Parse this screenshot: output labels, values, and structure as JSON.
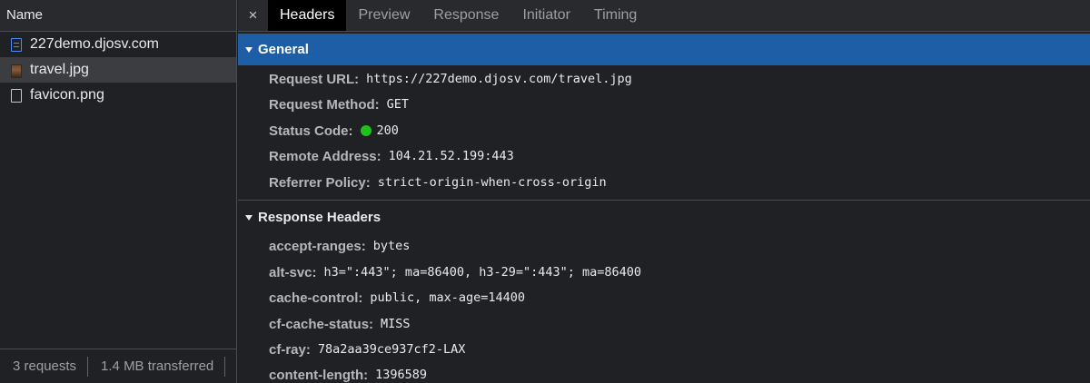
{
  "left": {
    "header": "Name",
    "requests": [
      {
        "name": "227demo.djosv.com",
        "icon": "document-icon"
      },
      {
        "name": "travel.jpg",
        "icon": "image-icon"
      },
      {
        "name": "favicon.png",
        "icon": "file-icon"
      }
    ],
    "footer": {
      "requests": "3 requests",
      "transferred": "1.4 MB transferred"
    }
  },
  "tabs": {
    "close": "×",
    "items": [
      "Headers",
      "Preview",
      "Response",
      "Initiator",
      "Timing"
    ],
    "active": "Headers"
  },
  "general": {
    "title": "General",
    "rows": [
      {
        "name": "Request URL:",
        "value": "https://227demo.djosv.com/travel.jpg"
      },
      {
        "name": "Request Method:",
        "value": "GET"
      },
      {
        "name": "Status Code:",
        "value": "200"
      },
      {
        "name": "Remote Address:",
        "value": "104.21.52.199:443"
      },
      {
        "name": "Referrer Policy:",
        "value": "strict-origin-when-cross-origin"
      }
    ]
  },
  "response_headers": {
    "title": "Response Headers",
    "rows": [
      {
        "name": "accept-ranges:",
        "value": "bytes"
      },
      {
        "name": "alt-svc:",
        "value": "h3=\":443\"; ma=86400, h3-29=\":443\"; ma=86400"
      },
      {
        "name": "cache-control:",
        "value": "public, max-age=14400"
      },
      {
        "name": "cf-cache-status:",
        "value": "MISS"
      },
      {
        "name": "cf-ray:",
        "value": "78a2aa39ce937cf2-LAX"
      },
      {
        "name": "content-length:",
        "value": "1396589"
      }
    ]
  },
  "colors": {
    "selected_section": "#1d5ea6",
    "status_ok": "#1ec21e",
    "background": "#202124"
  }
}
